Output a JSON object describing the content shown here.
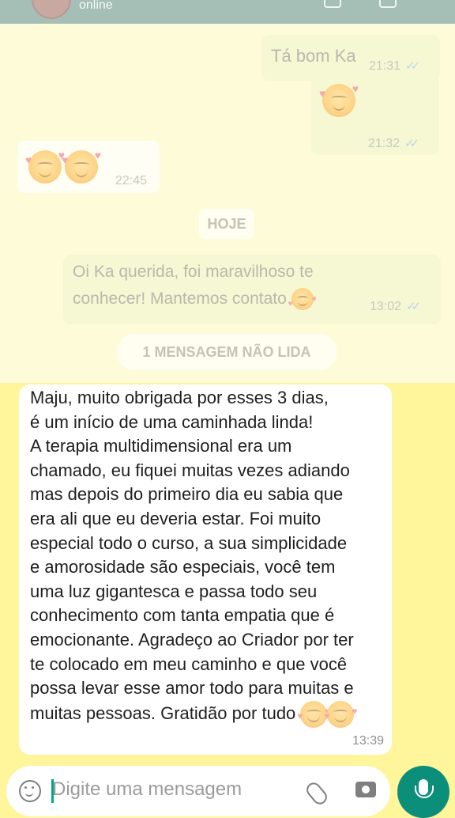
{
  "header": {
    "status": "online"
  },
  "messages": {
    "m1": {
      "text": "Tá bom Ka",
      "time": "21:31"
    },
    "m2": {
      "time": "21:32"
    },
    "m3": {
      "time": "22:45"
    },
    "date_label": "HOJE",
    "m4": {
      "text": "Oi Ka querida, foi maravilhoso te conhecer! Mantemos contato",
      "time": "13:02"
    },
    "unread_label": "1 MENSAGEM NÃO LIDA",
    "main": {
      "text": "Maju, muito obrigada por esses 3 dias,\né um início de uma caminhada linda!\nA terapia multidimensional era um\nchamado, eu fiquei muitas vezes adiando\nmas depois do primeiro dia eu sabia que\nera ali que eu deveria estar. Foi muito\nespecial todo o curso, a sua simplicidade\ne amorosidade são especiais, você tem\numa luz gigantesca e passa todo seu\nconhecimento com tanta empatia que é\nemocionante. Agradeço ao Criador por ter\nte colocado em meu caminho e que você\npossa levar esse amor todo para muitas e\nmuitas pessoas. Gratidão por tudo",
      "time": "13:39"
    }
  },
  "input": {
    "placeholder": "Digite uma mensagem"
  },
  "icons": {
    "emoji": "smiling-face-with-hearts-icon",
    "kiss": "kissing-face-icon",
    "keyboard_emoji": "emoji-keyboard-icon",
    "attach": "paperclip-icon",
    "camera": "camera-icon",
    "mic": "microphone-icon"
  },
  "colors": {
    "header": "#a5bfb6",
    "chat_bg": "#fff59b",
    "mic": "#0b8f7a"
  }
}
